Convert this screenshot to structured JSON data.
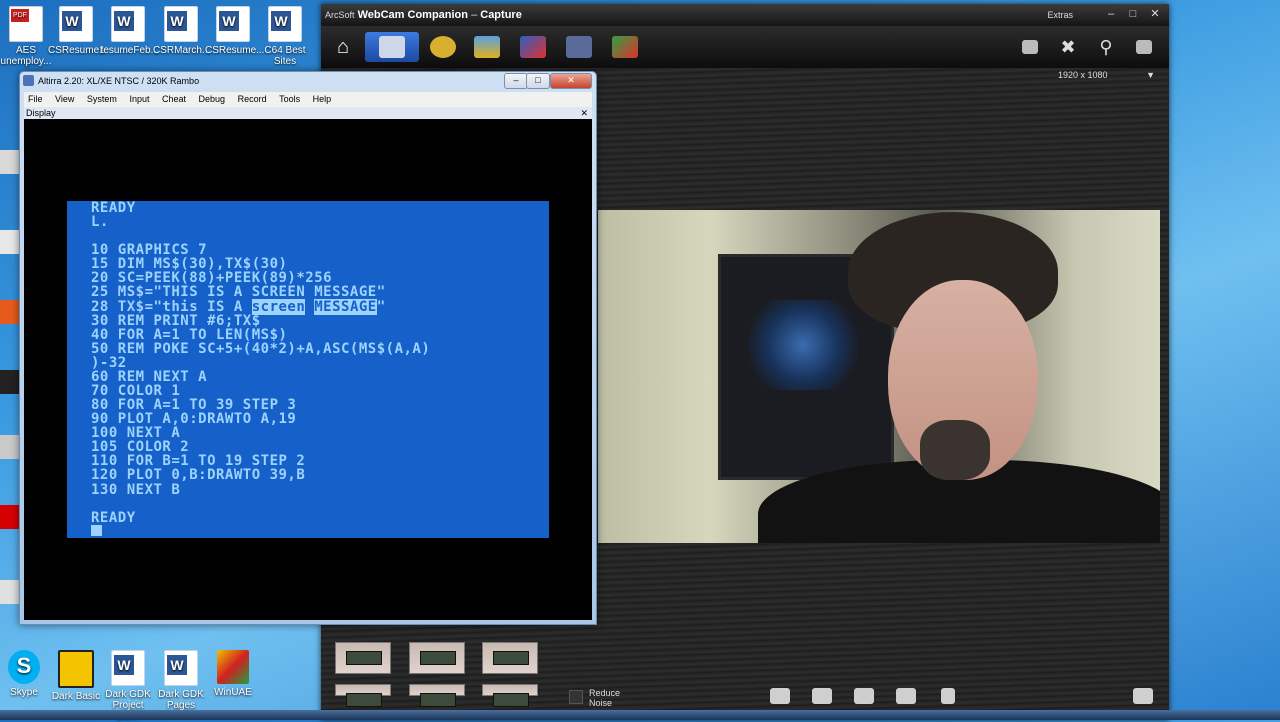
{
  "desktop": {
    "top_icons": [
      {
        "label": "AES unemploy...",
        "type": "pdf"
      },
      {
        "label": "CSResume1",
        "type": "word"
      },
      {
        "label": "resumeFeb...",
        "type": "word"
      },
      {
        "label": "CSRMarch...",
        "type": "word"
      },
      {
        "label": "CSResume...",
        "type": "word"
      },
      {
        "label": "C64 Best Sites",
        "type": "word"
      }
    ],
    "bottom_icons": [
      {
        "label": "Skype"
      },
      {
        "label": "Dark Basic"
      },
      {
        "label": "Dark GDK Project Bar..."
      },
      {
        "label": "Dark GDK Pages"
      },
      {
        "label": "WinUAE"
      }
    ]
  },
  "arcsoft": {
    "brand": "ArcSoft",
    "title": "WebCam Companion",
    "subtitle": "Capture",
    "extras_label": "Extras",
    "resolution": "1920 x 1080",
    "reduce_noise_label": "Reduce Noise",
    "colors": {
      "chrome": "#111111",
      "accent": "#2a5fb8"
    },
    "toolbar_icons": [
      "home-icon",
      "capture-icon",
      "fun-frames-icon",
      "photo-editor-icon",
      "video-editor-icon",
      "video-surveillance-icon",
      "effects-icon"
    ],
    "right_tools": [
      "layout-icon",
      "settings-icon",
      "zoom-icon",
      "export-icon"
    ],
    "bottom_tools": [
      "snapshot-icon",
      "frame-icon",
      "effects-tool-icon",
      "record-icon",
      "face-tracking-icon"
    ]
  },
  "altirra": {
    "title": "Altirra 2.20: XL/XE NTSC / 320K Rambo",
    "menu": [
      "File",
      "View",
      "System",
      "Input",
      "Cheat",
      "Debug",
      "Record",
      "Tools",
      "Help"
    ],
    "pane_title": "Display",
    "screen": {
      "bg_color": "#1560c9",
      "fg_color": "#9cd3ff",
      "lines": [
        "READY",
        "L.",
        "",
        "10 GRAPHICS 7",
        "15 DIM MS$(30),TX$(30)",
        "20 SC=PEEK(88)+PEEK(89)*256",
        "25 MS$=\"THIS IS A SCREEN MESSAGE\"",
        "28 TX$=\"this IS A ",
        "30 REM PRINT #6;TX$",
        "40 FOR A=1 TO LEN(MS$)",
        "50 REM POKE SC+5+(40*2)+A,ASC(MS$(A,A)",
        ")-32",
        "60 REM NEXT A",
        "70 COLOR 1",
        "80 FOR A=1 TO 39 STEP 3",
        "90 PLOT A,0:DRAWTO A,19",
        "100 NEXT A",
        "105 COLOR 2",
        "110 FOR B=1 TO 19 STEP 2",
        "120 PLOT 0,B:DRAWTO 39,B",
        "130 NEXT B",
        "",
        "READY"
      ],
      "inverse_1": "screen",
      "inverse_2": "MESSAGE",
      "tail": "\""
    }
  }
}
